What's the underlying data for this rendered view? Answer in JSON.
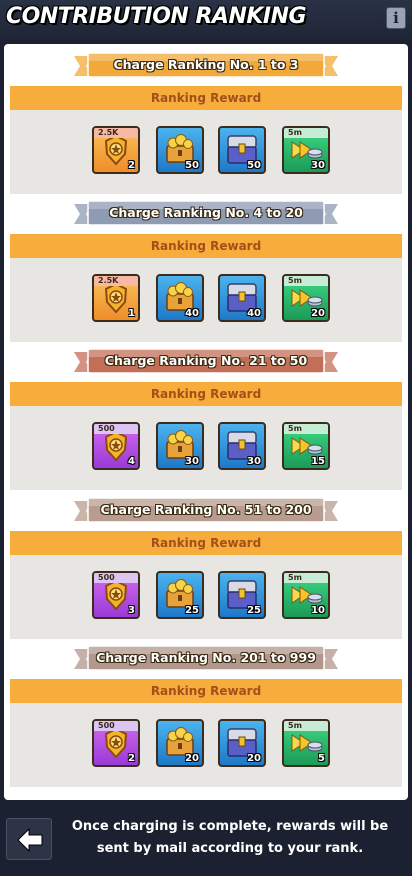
{
  "header": {
    "title": "CONTRIBUTION RANKING"
  },
  "tiers": [
    {
      "banner": "Charge Ranking No. 1 to 3",
      "banner_color": "#f2a93a",
      "reward_label": "Ranking Reward",
      "items": [
        {
          "icon": "gold-badge-icon",
          "color": "orange",
          "tag": "2.5K",
          "qty": "2"
        },
        {
          "icon": "gold-chest-icon",
          "color": "blue",
          "tag": "",
          "qty": "50"
        },
        {
          "icon": "blue-chest-icon",
          "color": "blue",
          "tag": "",
          "qty": "50"
        },
        {
          "icon": "speedup-coins-icon",
          "color": "green",
          "tag": "5m",
          "qty": "30"
        }
      ]
    },
    {
      "banner": "Charge Ranking No. 4 to 20",
      "banner_color": "#8e9bb3",
      "reward_label": "Ranking Reward",
      "items": [
        {
          "icon": "gold-badge-icon",
          "color": "orange",
          "tag": "2.5K",
          "qty": "1"
        },
        {
          "icon": "gold-chest-icon",
          "color": "blue",
          "tag": "",
          "qty": "40"
        },
        {
          "icon": "blue-chest-icon",
          "color": "blue",
          "tag": "",
          "qty": "40"
        },
        {
          "icon": "speedup-coins-icon",
          "color": "green",
          "tag": "5m",
          "qty": "20"
        }
      ]
    },
    {
      "banner": "Charge Ranking No. 21 to 50",
      "banner_color": "#c36f58",
      "reward_label": "Ranking Reward",
      "items": [
        {
          "icon": "gold-badge-icon",
          "color": "purple",
          "tag": "500",
          "qty": "4"
        },
        {
          "icon": "gold-chest-icon",
          "color": "blue",
          "tag": "",
          "qty": "30"
        },
        {
          "icon": "blue-chest-icon",
          "color": "blue",
          "tag": "",
          "qty": "30"
        },
        {
          "icon": "speedup-coins-icon",
          "color": "green",
          "tag": "5m",
          "qty": "15"
        }
      ]
    },
    {
      "banner": "Charge Ranking No. 51 to 200",
      "banner_color": "#b89c8f",
      "reward_label": "Ranking Reward",
      "items": [
        {
          "icon": "gold-badge-icon",
          "color": "purple",
          "tag": "500",
          "qty": "3"
        },
        {
          "icon": "gold-chest-icon",
          "color": "blue",
          "tag": "",
          "qty": "25"
        },
        {
          "icon": "blue-chest-icon",
          "color": "blue",
          "tag": "",
          "qty": "25"
        },
        {
          "icon": "speedup-coins-icon",
          "color": "green",
          "tag": "5m",
          "qty": "10"
        }
      ]
    },
    {
      "banner": "Charge Ranking No. 201 to 999",
      "banner_color": "#b2978c",
      "reward_label": "Ranking Reward",
      "items": [
        {
          "icon": "gold-badge-icon",
          "color": "purple",
          "tag": "500",
          "qty": "2"
        },
        {
          "icon": "gold-chest-icon",
          "color": "blue",
          "tag": "",
          "qty": "20"
        },
        {
          "icon": "blue-chest-icon",
          "color": "blue",
          "tag": "",
          "qty": "20"
        },
        {
          "icon": "speedup-coins-icon",
          "color": "green",
          "tag": "5m",
          "qty": "5"
        }
      ]
    }
  ],
  "footer": {
    "notice": "Once charging is complete, rewards will be sent by mail according to your rank."
  }
}
